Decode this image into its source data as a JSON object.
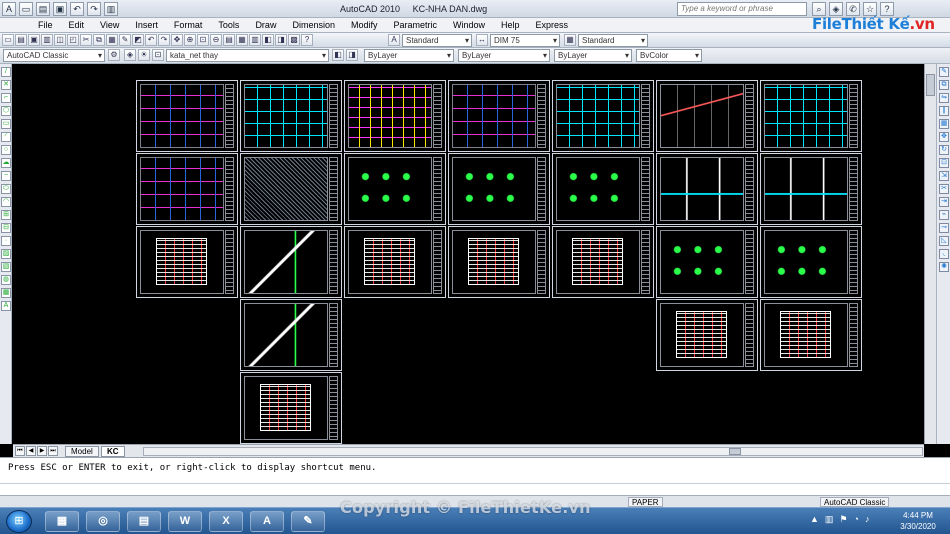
{
  "title": {
    "app": "AutoCAD 2010",
    "file": "KC-NHA DAN.dwg",
    "search_placeholder": "Type a keyword or phrase"
  },
  "logo": {
    "part1": "File",
    "part2": "Thiết Kế",
    "part3": ".vn"
  },
  "menu": [
    "File",
    "Edit",
    "View",
    "Insert",
    "Format",
    "Tools",
    "Draw",
    "Dimension",
    "Modify",
    "Parametric",
    "Window",
    "Help",
    "Express"
  ],
  "toolbar": {
    "text_style": "Standard",
    "dim_style": "DIM 75",
    "table_style": "Standard",
    "workspace": "AutoCAD Classic",
    "layer": "kata_net thay",
    "color": "ByLayer",
    "linetype": "ByLayer",
    "lineweight": "ByLayer",
    "plotstyle": "BvColor"
  },
  "tabs": {
    "model": "Model",
    "layout": "KC"
  },
  "command": {
    "prompt": "Press ESC or ENTER to exit, or right-click to display shortcut menu."
  },
  "status": {
    "paper": "PAPER",
    "workspace": "AutoCAD Classic"
  },
  "watermark": "Copyright © FileThietKe.vn",
  "clock": {
    "time": "4:44 PM",
    "date": "3/30/2020"
  },
  "colors": {
    "accent": "#1e7fd8",
    "brand_red": "#e02424",
    "canvas": "#000000"
  }
}
